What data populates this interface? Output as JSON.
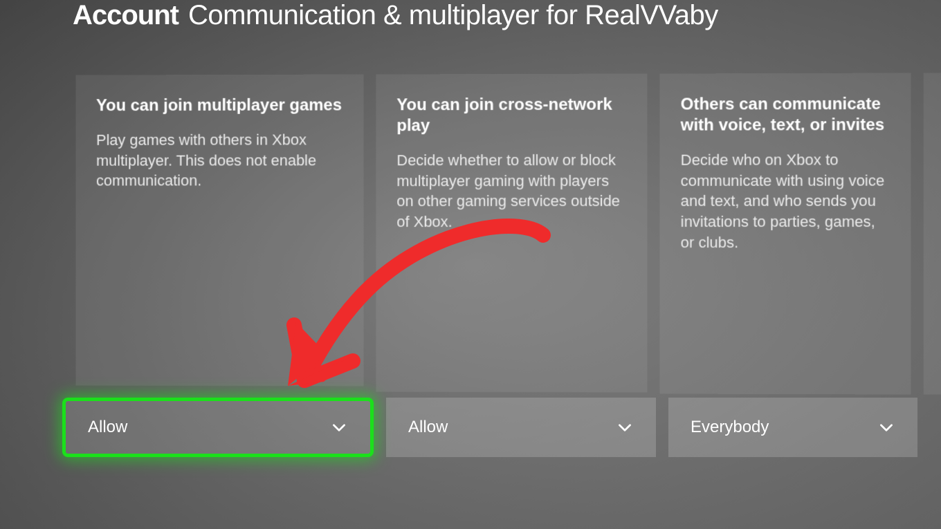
{
  "header": {
    "section": "Account",
    "title": "Communication & multiplayer for RealVVaby"
  },
  "cards": [
    {
      "title": "You can join multiplayer games",
      "description": "Play games with others in Xbox multiplayer. This does not enable communication.",
      "selected_value": "Allow"
    },
    {
      "title": "You can join cross-network play",
      "description": "Decide whether to allow or block multiplayer gaming with players on other gaming services outside of Xbox.",
      "selected_value": "Allow"
    },
    {
      "title": "Others can communicate with voice, text, or invites",
      "description": "Decide who on Xbox to communicate with using voice and text, and who sends you invitations to parties, games, or clubs.",
      "selected_value": "Everybody"
    }
  ],
  "colors": {
    "highlight": "#1be01b",
    "annotation_arrow": "#ef2b2b"
  }
}
